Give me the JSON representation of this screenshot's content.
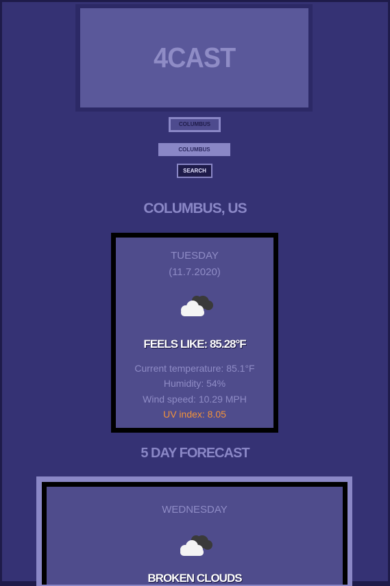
{
  "app": {
    "logo": "4CAST"
  },
  "search": {
    "history_label": "COLUMBUS",
    "input_value": "COLUMBUS",
    "button_label": "SEARCH"
  },
  "current": {
    "city": "COLUMBUS, US",
    "day": "TUESDAY",
    "date": "(11.7.2020)",
    "icon": "broken-clouds-icon",
    "feels_like": "FEELS LIKE: 85.28°F",
    "temperature": "Current temperature: 85.1°F",
    "humidity": "Humidity: 54%",
    "wind": "Wind speed: 10.29 MPH",
    "uv": "UV index: 8.05"
  },
  "forecast": {
    "title": "5 DAY FORECAST",
    "days": [
      {
        "day": "WEDNESDAY",
        "icon": "broken-clouds-icon",
        "description": "BROKEN CLOUDS"
      }
    ]
  },
  "colors": {
    "background": "#353274",
    "card": "#4f4c8c",
    "accent": "#8a87c6",
    "uv_warning": "#f3933a"
  }
}
